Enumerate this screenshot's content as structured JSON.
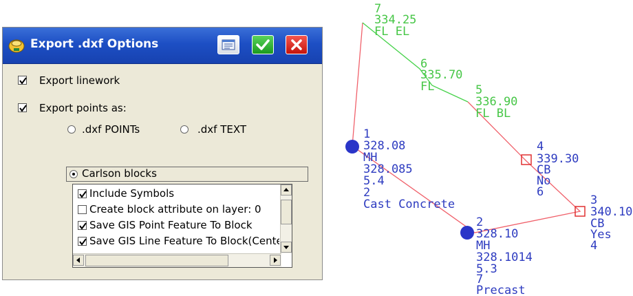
{
  "dialog": {
    "title": "Export .dxf Options",
    "export_linework_label": "Export linework",
    "export_linework_checked": true,
    "export_points_label": "Export points as:",
    "export_points_checked": true,
    "radio_options": [
      {
        "label": ".dxf POINTs",
        "selected": false
      },
      {
        "label": ".dxf TEXT",
        "selected": false
      },
      {
        "label": "Carlson blocks",
        "selected": true
      }
    ],
    "list_items": [
      {
        "label": "Include Symbols",
        "checked": true
      },
      {
        "label": "Create block attribute on layer: 0",
        "checked": false
      },
      {
        "label": "Save GIS Point Feature To Block",
        "checked": true
      },
      {
        "label": "Save GIS Line Feature To Block(Cente",
        "checked": true
      }
    ]
  },
  "drawing": {
    "colors": {
      "red_line": "#f0606a",
      "green_line": "#46d24a",
      "blue": "#2d3bc0",
      "green_text": "#46c646"
    },
    "green_points": [
      {
        "id": "7",
        "elevation": "334.25",
        "code": "FL EL"
      },
      {
        "id": "6",
        "elevation": "335.70",
        "code": "FL"
      },
      {
        "id": "5",
        "elevation": "336.90",
        "code": "FL BL"
      }
    ],
    "blue_points": [
      {
        "id": "1",
        "elevation": "328.08",
        "lines": [
          "MH",
          "328.085",
          "5.4",
          "2",
          "Cast Concrete"
        ]
      },
      {
        "id": "2",
        "elevation": "328.10",
        "lines": [
          "MH",
          "328.1014",
          "5.3",
          "7",
          "Precast"
        ]
      },
      {
        "id": "4",
        "elevation": "339.30",
        "lines": [
          "CB",
          "No",
          "6"
        ]
      },
      {
        "id": "3",
        "elevation": "340.10",
        "lines": [
          "CB",
          "Yes",
          "4"
        ]
      }
    ]
  }
}
